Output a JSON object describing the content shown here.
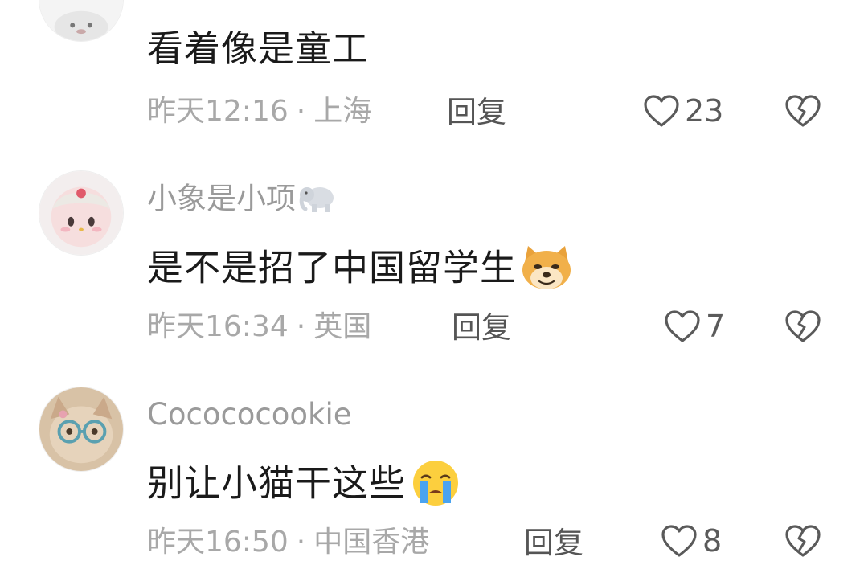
{
  "comments": [
    {
      "username": "",
      "content": "看着像是童工",
      "time": "昨天12:16",
      "location": "上海",
      "reply_label": "回复",
      "likes": "23"
    },
    {
      "username": "小象是小项",
      "username_icon": "elephant-emoji",
      "content": "是不是招了中国留学生",
      "content_emoji": "doge-emoji",
      "time": "昨天16:34",
      "location": "英国",
      "reply_label": "回复",
      "likes": "7"
    },
    {
      "username": "Cocococookie",
      "content": "别让小猫干这些",
      "content_emoji": "crying-face-emoji",
      "time": "昨天16:50",
      "location": "中国香港",
      "reply_label": "回复",
      "likes": "8"
    }
  ],
  "separator": "·",
  "icons": {
    "like": "heart-outline-icon",
    "dislike": "broken-heart-icon"
  },
  "colors": {
    "text_primary": "#1a1a1a",
    "text_secondary": "#a8a8a8",
    "username": "#9a9a9a",
    "reply": "#555555"
  }
}
